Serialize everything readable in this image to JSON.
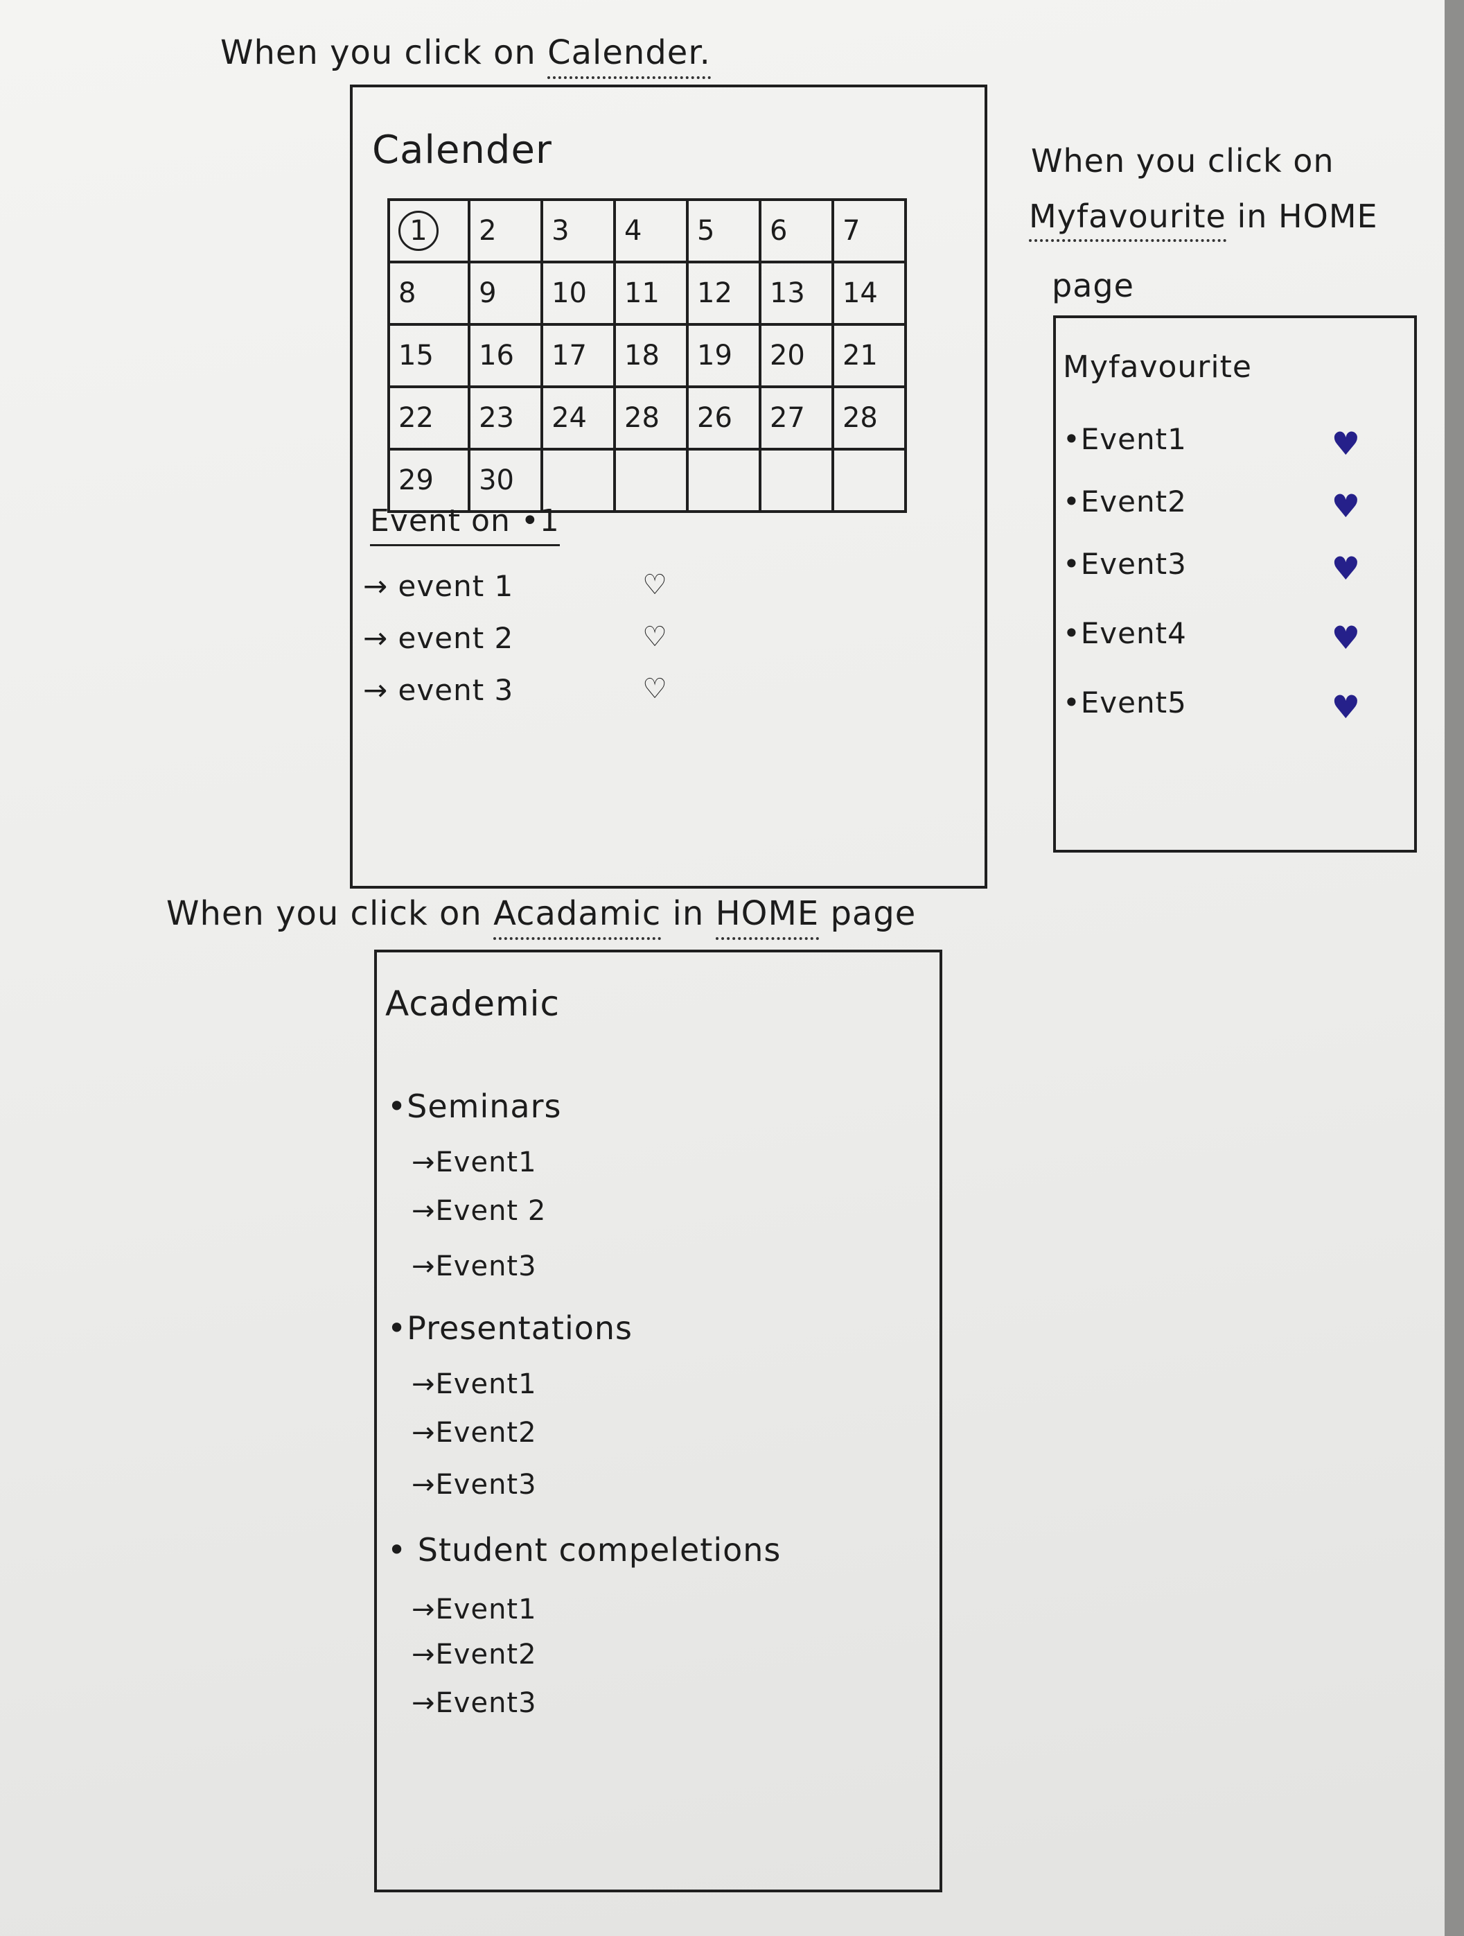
{
  "headings": {
    "calendar": {
      "before": "When you click on ",
      "link": "Calender."
    },
    "favourite": {
      "line1": "When you click on",
      "link": "Myfavourite",
      "after": " in HOME",
      "line3": "page"
    },
    "academic": {
      "before": "When you click on ",
      "link": "Acadamic",
      "mid": " in ",
      "link2": "HOME",
      "after": " page"
    }
  },
  "calendar": {
    "title": "Calender",
    "weeks": [
      [
        "1",
        "2",
        "3",
        "4",
        "5",
        "6",
        "7"
      ],
      [
        "8",
        "9",
        "10",
        "11",
        "12",
        "13",
        "14"
      ],
      [
        "15",
        "16",
        "17",
        "18",
        "19",
        "20",
        "21"
      ],
      [
        "22",
        "23",
        "24",
        "28",
        "26",
        "27",
        "28"
      ],
      [
        "29",
        "30",
        "",
        "",
        "",
        "",
        ""
      ]
    ],
    "selected_day": "1",
    "events_heading": "Event on •1",
    "events": [
      "→ event 1",
      "→ event 2",
      "→ event 3"
    ],
    "heart_icon": "heart-outline-icon"
  },
  "favourites": {
    "title": "Myfavourite",
    "items": [
      "•Event1",
      "•Event2",
      "•Event3",
      "•Event4",
      "•Event5"
    ],
    "heart_color": "#25208a"
  },
  "academic": {
    "title": "Academic",
    "sections": [
      {
        "label": "•Seminars",
        "events": [
          "→Event1",
          "→Event 2",
          "→Event3"
        ]
      },
      {
        "label": "•Presentations",
        "events": [
          "→Event1",
          "→Event2",
          "→Event3"
        ]
      },
      {
        "label": "• Student compeletions",
        "events": [
          "→Event1",
          "→Event2",
          "→Event3"
        ]
      }
    ]
  }
}
